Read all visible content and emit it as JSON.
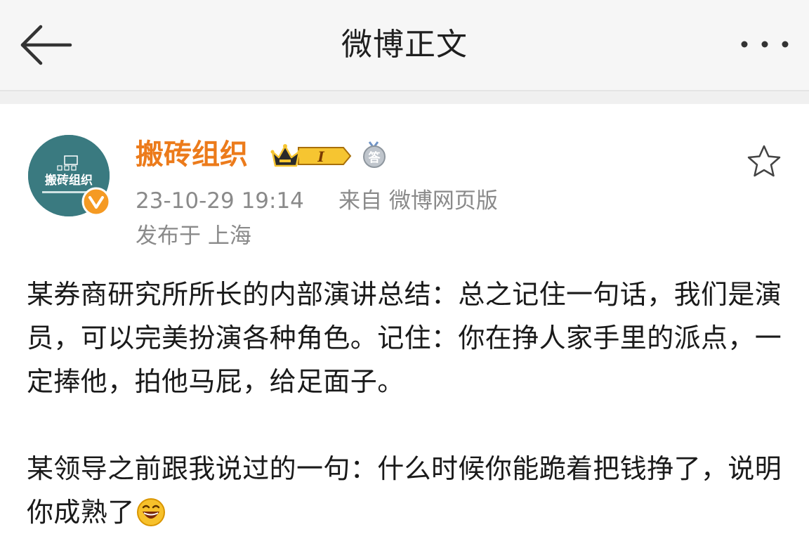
{
  "header": {
    "title": "微博正文",
    "back_icon": "back-arrow-icon",
    "more_icon": "more-dots-icon"
  },
  "post": {
    "author": {
      "name": "搬砖组织",
      "avatar_text": "搬砖组织",
      "avatar_color": "#3a7a80",
      "verified_color": "#f59a23",
      "name_color": "#ec7b1b",
      "vip_level": "I",
      "answer_badge": "答"
    },
    "time": "23-10-29 19:14",
    "source": "来自 微博网页版",
    "location": "发布于 上海",
    "paragraphs": [
      "某券商研究所所长的内部演讲总结：总之记住一句话，我们是演员，可以完美扮演各种角色。记住：你在挣人家手里的派点，一定捧他，拍他马屁，给足面子。",
      "某领导之前跟我说过的一句：什么时候你能跪着把钱挣了，说明你成熟了"
    ],
    "emoji": "laugh-emoji"
  }
}
